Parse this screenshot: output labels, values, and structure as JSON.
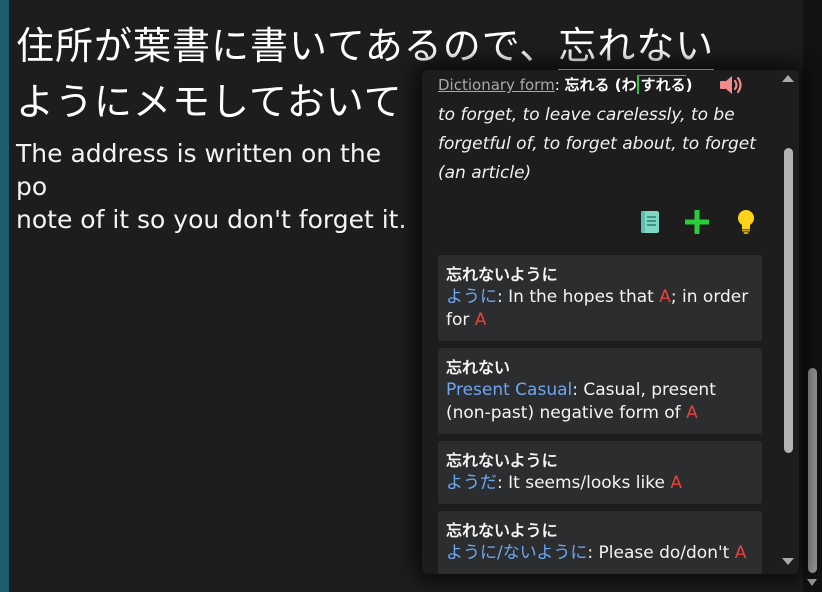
{
  "sentence": {
    "japanese_before": "住所が葉書に書いてあるので、",
    "japanese_target": "忘れない",
    "japanese_line2": "ようにメモしておいて",
    "english": "The address is written on the po\nnote of it so you don't forget it."
  },
  "popup": {
    "dictionary_label": "Dictionary form",
    "dictionary_sep": ": ",
    "dictionary_word": "忘れる",
    "reading_open": " (わ",
    "reading_boxed": "すれる",
    "reading_close": ")",
    "definition": "to forget, to leave carelessly, to be forgetful of, to forget about, to forget (an article)",
    "icons": [
      "speaker-icon",
      "book-icon",
      "plus-icon",
      "lightbulb-icon"
    ],
    "colors": {
      "accent_green": "#2bcc3b",
      "grammar_blue": "#6ea6f2",
      "variable_red": "#e8413e",
      "speaker_pink": "#f28b8b",
      "book_teal": "#7fd7c4",
      "bulb_yellow": "#ffd21a"
    },
    "grammar_cards": [
      {
        "title": "忘れないように",
        "name": "ように",
        "desc_a": ": In the hopes that ",
        "var1": "A",
        "desc_b": "; in order for ",
        "var2": "A"
      },
      {
        "title": "忘れない",
        "name": "Present Casual",
        "desc_a": ": Casual, present (non-past) negative form of ",
        "var1": "A",
        "desc_b": "",
        "var2": ""
      },
      {
        "title": "忘れないように",
        "name": "ようだ",
        "desc_a": ": It seems/looks like ",
        "var1": "A",
        "desc_b": "",
        "var2": ""
      },
      {
        "title": "忘れないように",
        "name": "ように/ないように",
        "desc_a": ": Please do/don't ",
        "var1": "A",
        "desc_b": "",
        "var2": ""
      }
    ]
  }
}
